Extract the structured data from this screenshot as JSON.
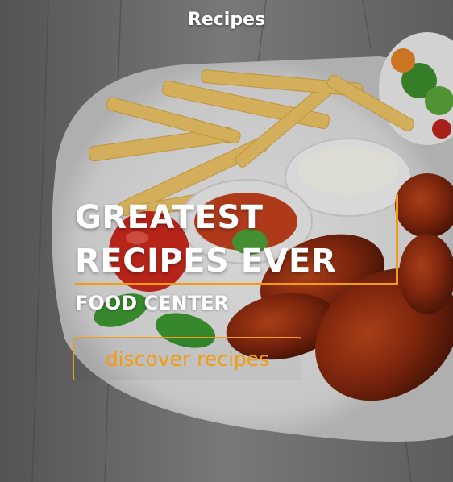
{
  "header": {
    "title": "Recipes"
  },
  "hero": {
    "headline_line1": "GREATEST",
    "headline_line2": "RECIPES EVER",
    "subtitle": "FOOD CENTER",
    "cta_label": "discover recipes"
  },
  "colors": {
    "accent": "#f39c12",
    "text": "#ffffff"
  },
  "icons": [
    "food-photo-background"
  ]
}
